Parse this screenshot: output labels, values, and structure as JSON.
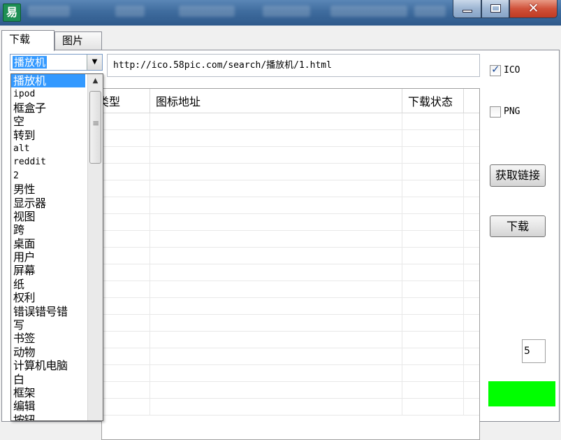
{
  "window": {
    "app_icon_glyph": "易"
  },
  "tabs": [
    {
      "label": "下载",
      "active": true
    },
    {
      "label": "图片",
      "active": false
    }
  ],
  "combo": {
    "selected": "播放机"
  },
  "url_field": {
    "value": "http://ico.58pic.com/search/播放机/1.html"
  },
  "grid": {
    "headers": [
      "类型",
      "图标地址",
      "下载状态"
    ],
    "rows": [
      [
        "",
        "",
        ""
      ],
      [
        "",
        "",
        ""
      ],
      [
        "",
        "",
        ""
      ],
      [
        "",
        "",
        ""
      ],
      [
        "",
        "",
        ""
      ],
      [
        "",
        "",
        ""
      ],
      [
        "",
        "",
        ""
      ],
      [
        "",
        "",
        ""
      ],
      [
        "",
        "",
        ""
      ],
      [
        "",
        "",
        ""
      ],
      [
        "",
        "",
        ""
      ],
      [
        "",
        "",
        ""
      ],
      [
        "",
        "",
        ""
      ],
      [
        "",
        "",
        ""
      ],
      [
        "",
        "",
        ""
      ],
      [
        "",
        "",
        ""
      ],
      [
        "",
        "",
        ""
      ],
      [
        "",
        "",
        ""
      ]
    ]
  },
  "options": {
    "ico_label": "ICO",
    "ico_checked": true,
    "png_label": "PNG",
    "png_checked": false
  },
  "buttons": {
    "get_links": "获取链接",
    "download": "下载"
  },
  "count_value": "5",
  "status_color": "#00ff00",
  "dropdown": {
    "items": [
      {
        "label": "播放机",
        "selected": true
      },
      {
        "label": "ipod",
        "mono": true
      },
      {
        "label": "框盒子"
      },
      {
        "label": "空"
      },
      {
        "label": "转到"
      },
      {
        "label": "alt",
        "mono": true
      },
      {
        "label": "reddit",
        "mono": true
      },
      {
        "label": "2",
        "mono": true
      },
      {
        "label": "男性"
      },
      {
        "label": "显示器"
      },
      {
        "label": "视图"
      },
      {
        "label": "跨"
      },
      {
        "label": "桌面"
      },
      {
        "label": "用户"
      },
      {
        "label": "屏幕"
      },
      {
        "label": "纸"
      },
      {
        "label": "权利"
      },
      {
        "label": "错误错号错"
      },
      {
        "label": "写"
      },
      {
        "label": "书签"
      },
      {
        "label": "动物"
      },
      {
        "label": "计算机电脑"
      },
      {
        "label": "白"
      },
      {
        "label": "框架"
      },
      {
        "label": "编辑"
      },
      {
        "label": "按钮"
      }
    ]
  }
}
